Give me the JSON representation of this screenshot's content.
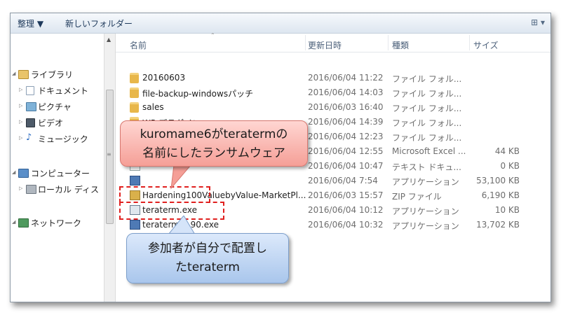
{
  "toolbar": {
    "organize": "整理 ▼",
    "new_folder": "新しいフォルダー",
    "view_button": "⊞ ▾"
  },
  "nav": {
    "libraries": "ライブラリ",
    "documents": "ドキュメント",
    "pictures": "ピクチャ",
    "videos": "ビデオ",
    "music": "ミュージック",
    "computer": "コンピューター",
    "local_disk": "ローカル ディス",
    "network": "ネットワーク"
  },
  "columns": {
    "name": "名前",
    "date": "更新日時",
    "type": "種類",
    "size": "サイズ"
  },
  "files": [
    {
      "name": "20160603",
      "date": "2016/06/04 11:22",
      "type": "ファイル フォル...",
      "size": "",
      "icon": "folder-icon"
    },
    {
      "name": "file-backup-windowsパッチ",
      "date": "2016/06/04 14:03",
      "type": "ファイル フォル...",
      "size": "",
      "icon": "folder-icon"
    },
    {
      "name": "sales",
      "date": "2016/06/03 16:40",
      "type": "ファイル フォル...",
      "size": "",
      "icon": "folder-icon"
    },
    {
      "name": "WP-プラグイン",
      "date": "2016/06/04 14:39",
      "type": "ファイル フォル...",
      "size": "",
      "icon": "folder-icon"
    },
    {
      "name": "",
      "date": "2016/06/04 12:23",
      "type": "ファイル フォル...",
      "size": "",
      "icon": "folder-icon"
    },
    {
      "name": "",
      "date": "2016/06/04 12:55",
      "type": "Microsoft Excel ...",
      "size": "44 KB",
      "icon": "excel-icon"
    },
    {
      "name": "",
      "date": "2016/06/04 10:47",
      "type": "テキスト ドキュ...",
      "size": "0 KB",
      "icon": "text-file-icon"
    },
    {
      "name": "",
      "date": "2016/06/04 7:54",
      "type": "アプリケーション",
      "size": "53,100 KB",
      "icon": "application-icon"
    },
    {
      "name": "Hardening100ValuebyValue-MarketPl...",
      "date": "2016/06/03 15:57",
      "type": "ZIP ファイル",
      "size": "6,190 KB",
      "icon": "zip-icon"
    },
    {
      "name": "teraterm.exe",
      "date": "2016/06/04 10:12",
      "type": "アプリケーション",
      "size": "10 KB",
      "icon": "teraterm-icon"
    },
    {
      "name": "teraterm-4.90.exe",
      "date": "2016/06/04 10:32",
      "type": "アプリケーション",
      "size": "13,702 KB",
      "icon": "teraterm-installer-icon"
    }
  ],
  "callouts": {
    "ransomware": [
      "kuromame6がteratermの",
      "名前にしたランサムウェア"
    ],
    "participant": [
      "参加者が自分で配置し",
      "たteraterm"
    ]
  },
  "colors": {
    "callout_red": "#f59f97",
    "callout_blue": "#a9c6ec",
    "highlight_border": "#e0201f"
  }
}
